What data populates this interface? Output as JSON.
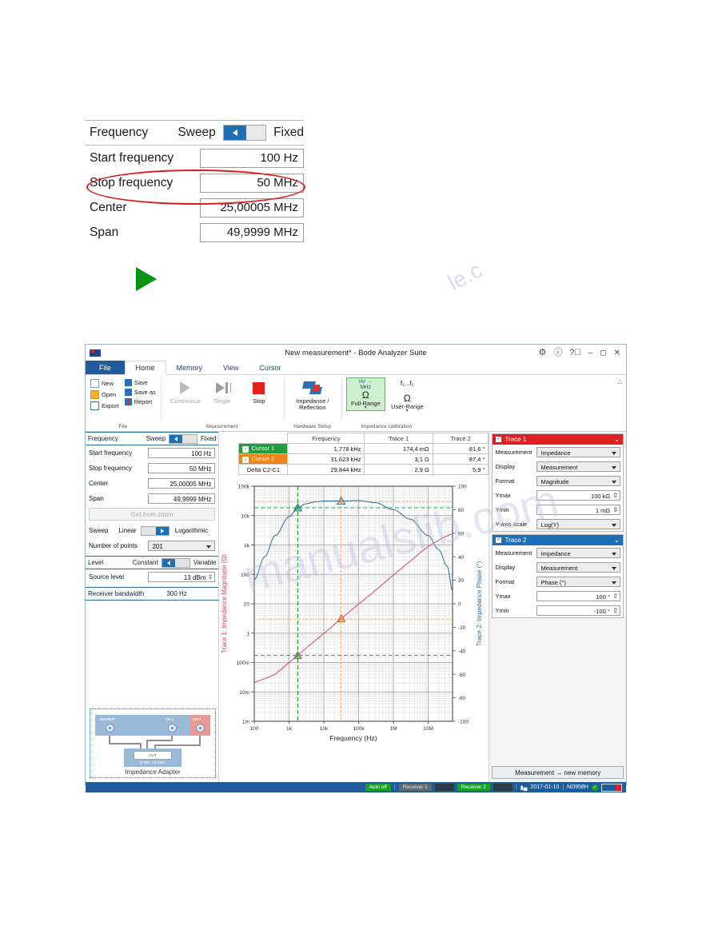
{
  "freq_panel": {
    "header": {
      "title": "Frequency",
      "left_mode": "Sweep",
      "right_mode": "Fixed"
    },
    "rows": [
      {
        "label": "Start frequency",
        "value": "100 Hz"
      },
      {
        "label": "Stop frequency",
        "value": "50 MHz"
      },
      {
        "label": "Center",
        "value": "25,00005 MHz"
      },
      {
        "label": "Span",
        "value": "49,9999 MHz"
      }
    ]
  },
  "app": {
    "title": "New measurement* - Bode Analyzer Suite",
    "titlebar_icons": [
      "gear-icon",
      "info-icon",
      "help-icon",
      "minimize-icon",
      "maximize-icon",
      "close-icon"
    ],
    "tabs": [
      {
        "label": "File",
        "state": "file"
      },
      {
        "label": "Home",
        "state": "active"
      },
      {
        "label": "Memory",
        "state": "normal"
      },
      {
        "label": "View",
        "state": "normal"
      },
      {
        "label": "Cursor",
        "state": "normal"
      }
    ],
    "ribbon": {
      "groups": [
        {
          "title": "File",
          "type": "file",
          "items": [
            {
              "label": "New",
              "icon": "new-file-icon"
            },
            {
              "label": "Save",
              "icon": "save-icon"
            },
            {
              "label": "Open",
              "icon": "open-folder-icon"
            },
            {
              "label": "Save as",
              "icon": "save-as-icon"
            },
            {
              "label": "Export",
              "icon": "export-icon"
            },
            {
              "label": "Report",
              "icon": "report-icon"
            }
          ]
        },
        {
          "title": "Measurement",
          "type": "measure",
          "items": [
            {
              "label": "Continuous",
              "icon": "play-icon",
              "disabled": true
            },
            {
              "label": "Single",
              "icon": "play-pause-icon",
              "disabled": true
            },
            {
              "label": "Stop",
              "icon": "stop-icon",
              "disabled": false
            }
          ]
        },
        {
          "title": "Hardware Setup",
          "type": "hardware",
          "items": [
            {
              "label": "Impedance / Reflection",
              "icon": "wrench-icon"
            }
          ]
        },
        {
          "title": "Impedance calibration",
          "type": "calib",
          "items": [
            {
              "top": "Hz →",
              "top2": "MHz",
              "omega": "Ω",
              "label": "Full-Range",
              "selected": true
            },
            {
              "top": "f₁...f₂",
              "top2": "",
              "omega": "Ω",
              "label": "User-Range",
              "selected": false
            }
          ]
        }
      ],
      "collapse_icon": "chevron-up-icon"
    },
    "left_settings": {
      "frequency": {
        "title": "Frequency",
        "left_mode": "Sweep",
        "right_mode": "Fixed",
        "rows": [
          {
            "label": "Start frequency",
            "value": "100 Hz"
          },
          {
            "label": "Stop frequency",
            "value": "50 MHz"
          },
          {
            "label": "Center",
            "value": "25,00005 MHz"
          },
          {
            "label": "Span",
            "value": "49,9999 MHz"
          }
        ],
        "get_from_zoom": "Get from zoom",
        "sweep_label": "Sweep",
        "sweep_left": "Linear",
        "sweep_right": "Logarithmic",
        "points_label": "Number of points",
        "points_value": "201"
      },
      "level": {
        "title": "Level",
        "left_mode": "Constant",
        "right_mode": "Variable",
        "source_label": "Source level",
        "source_value": "13 dBm"
      },
      "bandwidth": {
        "label": "Receiver bandwidth",
        "value": "300 Hz"
      },
      "adapter": {
        "title": "Impedance Adapter",
        "output_label": "OUTPUT",
        "ch1_label": "CH 1",
        "ch2_label": "CH 2",
        "dut_label": "DUT",
        "connector_label": "B-WIC / B-SMC"
      }
    },
    "cursor_table": {
      "headers": [
        "",
        "Frequency",
        "Trace 1",
        "Trace 2"
      ],
      "rows": [
        {
          "name": "Cursor 1",
          "checked": true,
          "color": "#1f9d3f",
          "frequency": "1,778 kHz",
          "trace1": "174,4 mΩ",
          "trace2": "81,6 °"
        },
        {
          "name": "Cursor 2",
          "checked": true,
          "color": "#f08418",
          "frequency": "31,623 kHz",
          "trace1": "3,1 Ω",
          "trace2": "87,4 °"
        },
        {
          "name": "Delta C2-C1",
          "checked": null,
          "color": "#ffffff",
          "frequency": "29,844 kHz",
          "trace1": "2,9 Ω",
          "trace2": "5,9 °"
        }
      ]
    },
    "trace_panels": [
      {
        "title": "Trace 1",
        "color": "#e02020",
        "rows": [
          {
            "label": "Measurement",
            "value": "Impedance",
            "kind": "select"
          },
          {
            "label": "Display",
            "value": "Measurement",
            "kind": "select"
          },
          {
            "label": "Format",
            "value": "Magnitude",
            "kind": "select"
          },
          {
            "label": "Ymax",
            "value": "100 kΩ",
            "kind": "number"
          },
          {
            "label": "Ymin",
            "value": "1 mΩ",
            "kind": "number"
          },
          {
            "label": "Y-axis scale",
            "value": "Log(Y)",
            "kind": "select"
          }
        ]
      },
      {
        "title": "Trace 2",
        "color": "#1f6fb4",
        "rows": [
          {
            "label": "Measurement",
            "value": "Impedance",
            "kind": "select"
          },
          {
            "label": "Display",
            "value": "Measurement",
            "kind": "select"
          },
          {
            "label": "Format",
            "value": "Phase (°)",
            "kind": "select"
          },
          {
            "label": "Ymax",
            "value": "100 °",
            "kind": "number"
          },
          {
            "label": "Ymin",
            "value": "-100 °",
            "kind": "number"
          }
        ]
      }
    ],
    "memory_button": "Measurement → new memory",
    "statusbar": {
      "auto": "Auto off",
      "receiver1": "Receiver 1",
      "receiver2": "Receiver 2",
      "date": "2017-01-10",
      "device": "ND958H",
      "chart_icon": "bar-chart-icon",
      "ok_icon": "check-icon"
    }
  },
  "chart_data": {
    "type": "line",
    "title": "",
    "xlabel": "Frequency (Hz)",
    "ylabel_left": "Trace 1: Impedance Magnitude (Ω)",
    "ylabel_right": "Trace 2: Impedance Phase (°)",
    "xscale": "log",
    "xlim": [
      100,
      50000000
    ],
    "xticks": [
      100,
      1000,
      10000,
      100000,
      1000000,
      10000000
    ],
    "xticklabels": [
      "100",
      "1k",
      "10k",
      "100k",
      "1M",
      "10M"
    ],
    "yscale_left": "log",
    "ylim_left": [
      0.001,
      100000
    ],
    "yticks_left": [
      0.001,
      0.01,
      0.1,
      1,
      10,
      100,
      1000,
      10000,
      100000
    ],
    "yticklabels_left": [
      "1m",
      "10m",
      "100m",
      "1",
      "10",
      "100",
      "1k",
      "10k",
      "100k"
    ],
    "ylim_right": [
      -100,
      100
    ],
    "yticks_right": [
      -100,
      -80,
      -60,
      -40,
      -20,
      0,
      20,
      40,
      60,
      80,
      100
    ],
    "grid": true,
    "legend": "none",
    "series": [
      {
        "name": "Trace 1: Impedance Magnitude",
        "color": "#d6455f",
        "axis": "left",
        "x": [
          100,
          200,
          400,
          1000,
          1778,
          3000,
          6000,
          10000,
          31623,
          100000,
          300000,
          1000000,
          3000000,
          10000000,
          30000000,
          50000000
        ],
        "y": [
          0.021,
          0.028,
          0.04,
          0.1,
          0.1744,
          0.3,
          0.59,
          0.98,
          3.1,
          9.8,
          28,
          95,
          280,
          900,
          1900,
          2400
        ]
      },
      {
        "name": "Trace 2: Impedance Phase",
        "color": "#2e6d9e",
        "axis": "right",
        "x": [
          100,
          200,
          400,
          1000,
          1778,
          3000,
          6000,
          10000,
          31623,
          100000,
          300000,
          1000000,
          3000000,
          10000000,
          20000000,
          35000000,
          50000000
        ],
        "y": [
          20.5,
          40,
          58,
          74,
          81.6,
          85,
          86.8,
          87.4,
          87.4,
          87.8,
          86,
          80,
          72,
          58,
          46,
          32,
          11
        ]
      }
    ],
    "cursors": [
      {
        "name": "Cursor 1",
        "color": "#1f9d3f",
        "x": 1778,
        "y_left": 0.1744,
        "y_right": 81.6
      },
      {
        "name": "Cursor 2",
        "color": "#f08418",
        "x": 31623,
        "y_left": 3.1,
        "y_right": 87.4
      }
    ]
  },
  "watermarks": [
    "le.c",
    "manualslib.com",
    "manualsli"
  ]
}
